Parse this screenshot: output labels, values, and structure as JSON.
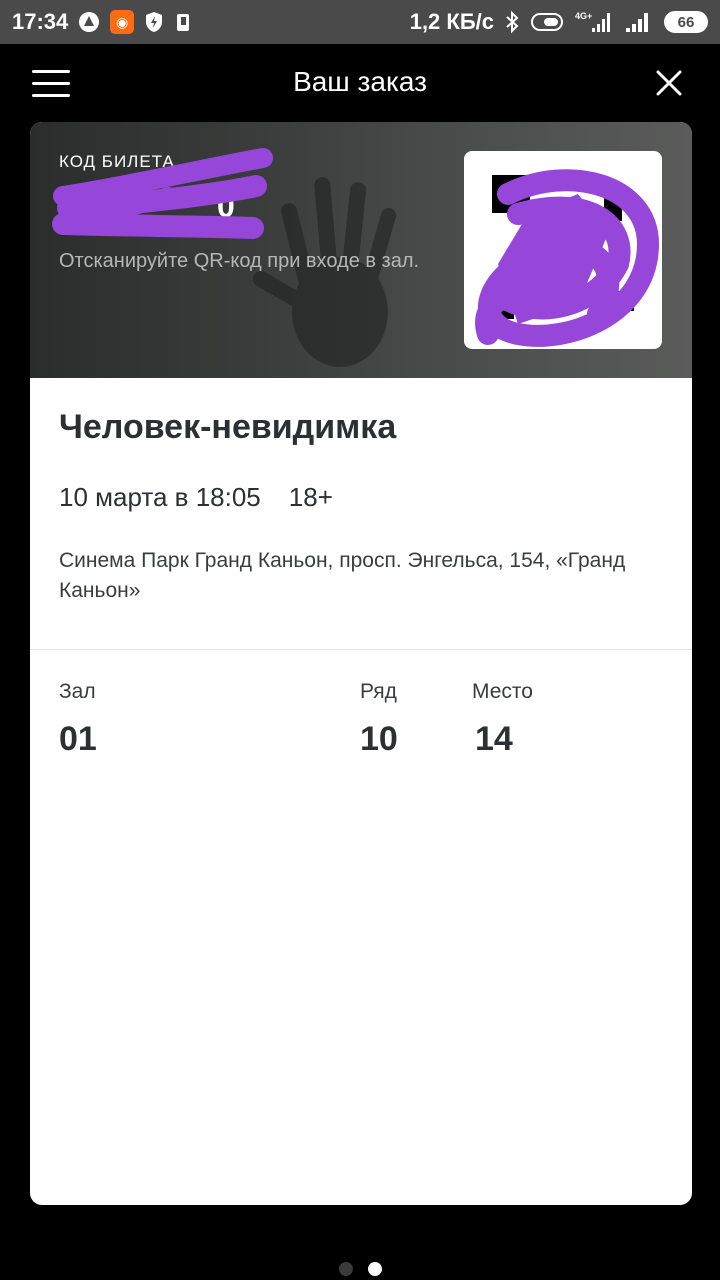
{
  "status_bar": {
    "time": "17:34",
    "network_speed": "1,2 КБ/с",
    "network_type": "4G+",
    "battery": "66",
    "icons": [
      "aptoide-icon",
      "app-notification-icon",
      "shield-bolt-icon",
      "phone-icon",
      "bluetooth-icon",
      "toggle-icon",
      "signal-icon",
      "signal-icon-2",
      "battery-icon"
    ]
  },
  "header": {
    "title": "Ваш заказ",
    "menu_icon": "hamburger-menu-icon",
    "close_icon": "close-icon"
  },
  "ticket": {
    "code_label": "КОД БИЛЕТА",
    "code_visible_fragment": "0",
    "scan_hint": "Отсканируйте QR-код при входе в зал.",
    "qr_icon": "qr-code",
    "redaction_color": "#9646d9"
  },
  "movie": {
    "title": "Человек-невидимка",
    "datetime": "10 марта в 18:05",
    "age_rating": "18+",
    "cinema": "Синема Парк Гранд Каньон, просп. Энгельса, 154, «Гранд Каньон»"
  },
  "seat": {
    "hall_label": "Зал",
    "hall_value": "01",
    "row_label": "Ряд",
    "row_value": "10",
    "seat_label": "Место",
    "seat_value": "14"
  },
  "pager": {
    "count": 2,
    "active_index": 1,
    "active_color": "#ffffff",
    "inactive_color": "#3a3a3a"
  }
}
